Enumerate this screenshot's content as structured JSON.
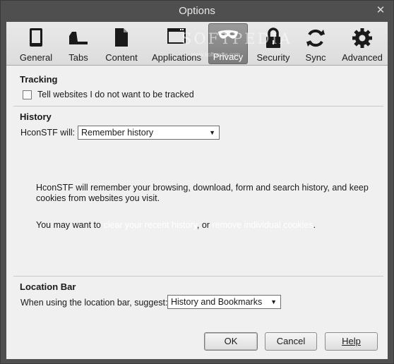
{
  "window": {
    "title": "Options",
    "close_glyph": "✕"
  },
  "tabs": [
    {
      "id": "general",
      "label": "General",
      "icon": "phone-icon"
    },
    {
      "id": "tabs",
      "label": "Tabs",
      "icon": "folder-tab-icon"
    },
    {
      "id": "content",
      "label": "Content",
      "icon": "document-icon"
    },
    {
      "id": "applications",
      "label": "Applications",
      "icon": "applications-icon"
    },
    {
      "id": "privacy",
      "label": "Privacy",
      "icon": "mask-icon",
      "active": true
    },
    {
      "id": "security",
      "label": "Security",
      "icon": "padlock-icon"
    },
    {
      "id": "sync",
      "label": "Sync",
      "icon": "sync-icon"
    },
    {
      "id": "advanced",
      "label": "Advanced",
      "icon": "gear-icon"
    }
  ],
  "watermark": {
    "text": "SOFTPEDIA",
    "sub": "www.softpedia.com"
  },
  "tracking": {
    "title": "Tracking",
    "checkbox_label": "Tell websites I do not want to be tracked",
    "checked": false
  },
  "history": {
    "title": "History",
    "will_label": "HconSTF will:",
    "select_value": "Remember history",
    "description_line1": "HconSTF will remember your browsing, download, form and search history, and keep",
    "description_line2": "cookies from websites you visit.",
    "want_prefix": "You may want to ",
    "link_clear": "clear your recent history",
    "want_middle": ", or ",
    "link_remove": "remove individual cookies",
    "want_suffix": "."
  },
  "location_bar": {
    "title": "Location Bar",
    "suggest_label": "When using the location bar, suggest:",
    "select_value": "History and Bookmarks"
  },
  "buttons": {
    "ok": "OK",
    "cancel": "Cancel",
    "help": "Help"
  }
}
